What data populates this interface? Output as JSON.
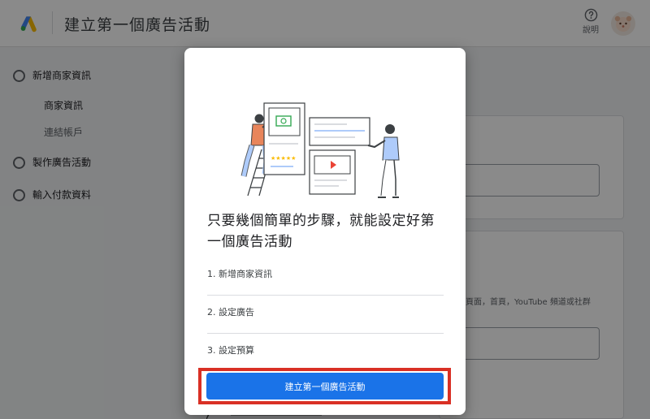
{
  "header": {
    "title": "建立第一個廣告活動",
    "help_label": "說明"
  },
  "sidebar": {
    "steps": [
      {
        "label": "新增商家資訊",
        "substeps": [
          "商家資訊",
          "連結帳戶"
        ]
      },
      {
        "label": "製作廣告活動"
      },
      {
        "label": "輸入付款資料"
      }
    ]
  },
  "background": {
    "hint_text": "頁面，首頁，YouTube 頻道或社群"
  },
  "dialog": {
    "title": "只要幾個簡單的步驟，就能設定好第一個廣告活動",
    "steps": [
      "1. 新增商家資訊",
      "2. 設定廣告",
      "3. 設定預算"
    ],
    "cta_label": "建立第一個廣告活動"
  },
  "colors": {
    "primary": "#1a73e8",
    "highlight_border": "#d93025",
    "scrim": "rgba(0,0,0,0.46)"
  }
}
